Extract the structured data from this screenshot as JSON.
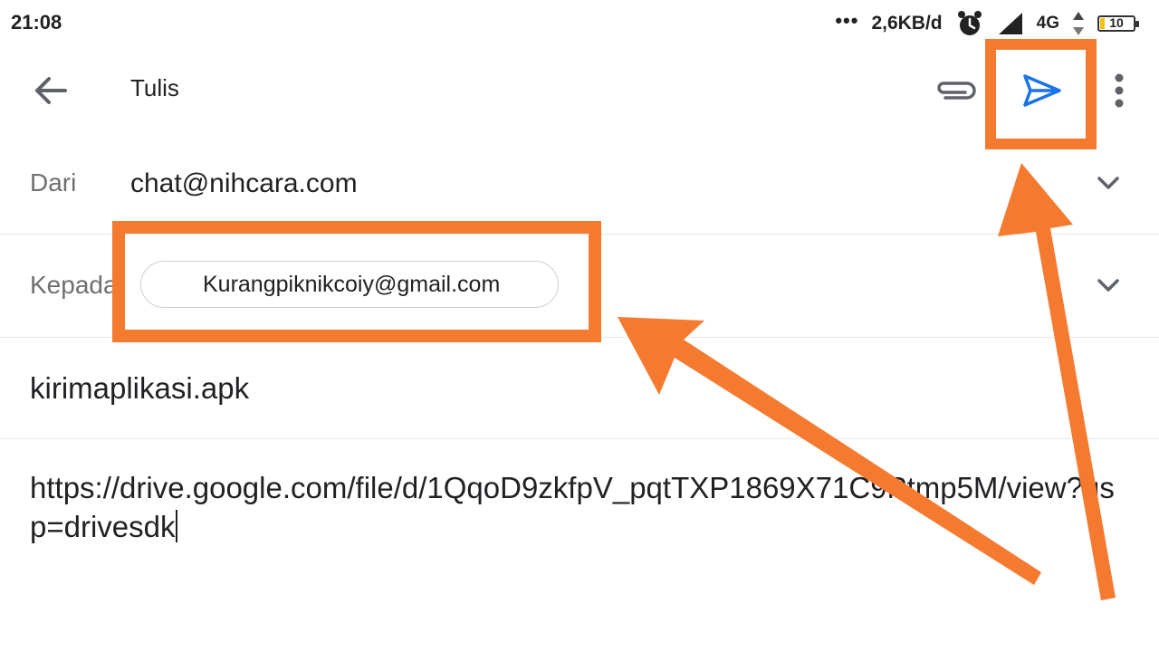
{
  "status_bar": {
    "time": "21:08",
    "dots": "•••",
    "speed": "2,6KB/d",
    "network": "4G",
    "battery_level": "10",
    "battery_fraction": 0.12,
    "icons": [
      "alarm-icon",
      "signal-icon",
      "data-arrows-icon",
      "battery-icon"
    ]
  },
  "toolbar": {
    "title": "Tulis",
    "icons": [
      "back-arrow-icon",
      "attach-icon",
      "send-icon",
      "more-vert-icon"
    ]
  },
  "compose": {
    "from_label": "Dari",
    "from_value": "chat@nihcara.com",
    "to_label": "Kepada",
    "to_chip": "Kurangpiknikcoiy@gmail.com",
    "subject": "kirimaplikasi.apk",
    "body": "https://drive.google.com/file/d/1QqoD9zkfpV_pqtTXP1869X71C9Ptmp5M/view?usp=drivesdk"
  },
  "colors": {
    "accent_send": "#1a73e8",
    "annotation": "#f47a30",
    "battery_fill": "#f4c20d"
  }
}
